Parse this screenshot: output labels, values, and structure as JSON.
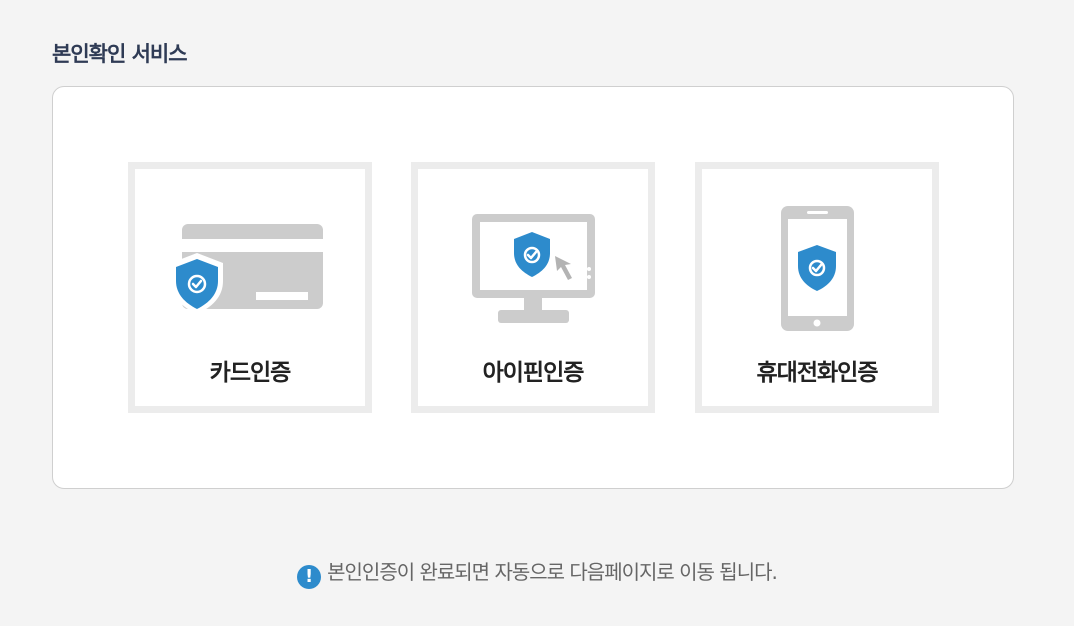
{
  "page": {
    "title": "본인확인 서비스"
  },
  "methods": [
    {
      "label": "카드인증",
      "icon": "credit-card-shield-icon"
    },
    {
      "label": "아이핀인증",
      "icon": "monitor-shield-icon"
    },
    {
      "label": "휴대전화인증",
      "icon": "mobile-phone-shield-icon"
    }
  ],
  "notice": {
    "icon": "exclamation-circle-icon",
    "icon_glyph": "!",
    "text": "본인인증이 완료되면 자동으로 다음페이지로 이동 됩니다."
  },
  "colors": {
    "shield": "#2d8bcc",
    "device_gray": "#cccccc",
    "card_border": "#ececec",
    "title": "#2f3b55"
  }
}
